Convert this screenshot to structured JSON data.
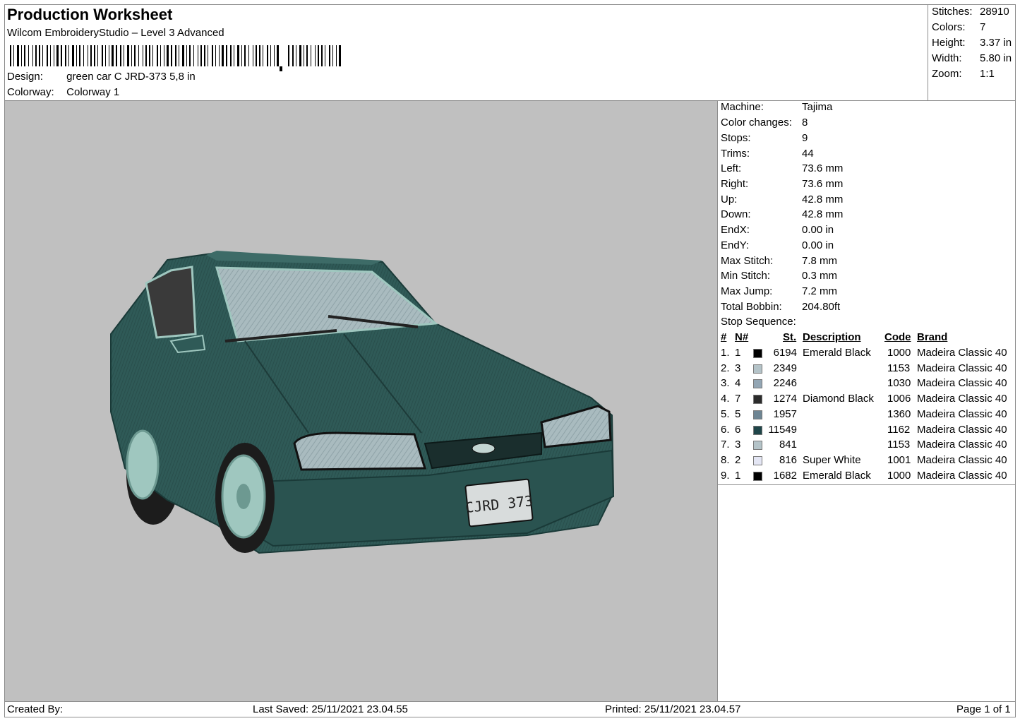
{
  "header": {
    "title": "Production Worksheet",
    "subtitle": "Wilcom EmbroideryStudio – Level 3 Advanced",
    "design_label": "Design:",
    "design_value": "green car C JRD-373 5,8 in",
    "colorway_label": "Colorway:",
    "colorway_value": "Colorway 1"
  },
  "summary": [
    {
      "label": "Stitches:",
      "value": "28910"
    },
    {
      "label": "Colors:",
      "value": "7"
    },
    {
      "label": "Height:",
      "value": "3.37 in"
    },
    {
      "label": "Width:",
      "value": "5.80 in"
    },
    {
      "label": "Zoom:",
      "value": "1:1"
    }
  ],
  "machine_info": [
    {
      "label": "Machine:",
      "value": "Tajima"
    },
    {
      "label": "Color changes:",
      "value": "8"
    },
    {
      "label": "Stops:",
      "value": "9"
    },
    {
      "label": "Trims:",
      "value": "44"
    },
    {
      "label": "Left:",
      "value": "73.6 mm"
    },
    {
      "label": "Right:",
      "value": "73.6 mm"
    },
    {
      "label": "Up:",
      "value": "42.8 mm"
    },
    {
      "label": "Down:",
      "value": "42.8 mm"
    },
    {
      "label": "EndX:",
      "value": "0.00 in"
    },
    {
      "label": "EndY:",
      "value": "0.00 in"
    },
    {
      "label": "Max Stitch:",
      "value": "7.8 mm"
    },
    {
      "label": "Min Stitch:",
      "value": "0.3 mm"
    },
    {
      "label": "Max Jump:",
      "value": "7.2 mm"
    },
    {
      "label": "Total Bobbin:",
      "value": "204.80ft"
    }
  ],
  "stop_sequence": {
    "title": "Stop Sequence:",
    "headers": {
      "num": "#",
      "n": "N#",
      "st": "St.",
      "desc": "Description",
      "code": "Code",
      "brand": "Brand"
    },
    "rows": [
      {
        "num": "1.",
        "n": "1",
        "color": "#000000",
        "st": "6194",
        "desc": "Emerald Black",
        "code": "1000",
        "brand": "Madeira Classic 40"
      },
      {
        "num": "2.",
        "n": "3",
        "color": "#b4c3c8",
        "st": "2349",
        "desc": "",
        "code": "1153",
        "brand": "Madeira Classic 40"
      },
      {
        "num": "3.",
        "n": "4",
        "color": "#93a6b4",
        "st": "2246",
        "desc": "",
        "code": "1030",
        "brand": "Madeira Classic 40"
      },
      {
        "num": "4.",
        "n": "7",
        "color": "#2b2b2b",
        "st": "1274",
        "desc": "Diamond Black",
        "code": "1006",
        "brand": "Madeira Classic 40"
      },
      {
        "num": "5.",
        "n": "5",
        "color": "#6e8593",
        "st": "1957",
        "desc": "",
        "code": "1360",
        "brand": "Madeira Classic 40"
      },
      {
        "num": "6.",
        "n": "6",
        "color": "#1f4549",
        "st": "11549",
        "desc": "",
        "code": "1162",
        "brand": "Madeira Classic 40"
      },
      {
        "num": "7.",
        "n": "3",
        "color": "#b4c3c8",
        "st": "841",
        "desc": "",
        "code": "1153",
        "brand": "Madeira Classic 40"
      },
      {
        "num": "8.",
        "n": "2",
        "color": "#e4e6f4",
        "st": "816",
        "desc": "Super White",
        "code": "1001",
        "brand": "Madeira Classic 40"
      },
      {
        "num": "9.",
        "n": "1",
        "color": "#000000",
        "st": "1682",
        "desc": "Emerald Black",
        "code": "1000",
        "brand": "Madeira Classic 40"
      }
    ]
  },
  "design_preview": {
    "license_plate": "CJRD 373",
    "car_color": "#2f5a57"
  },
  "footer": {
    "created_by": "Created By:",
    "last_saved": "Last Saved: 25/11/2021 23.04.55",
    "printed": "Printed: 25/11/2021 23.04.57",
    "page": "Page 1 of 1"
  }
}
